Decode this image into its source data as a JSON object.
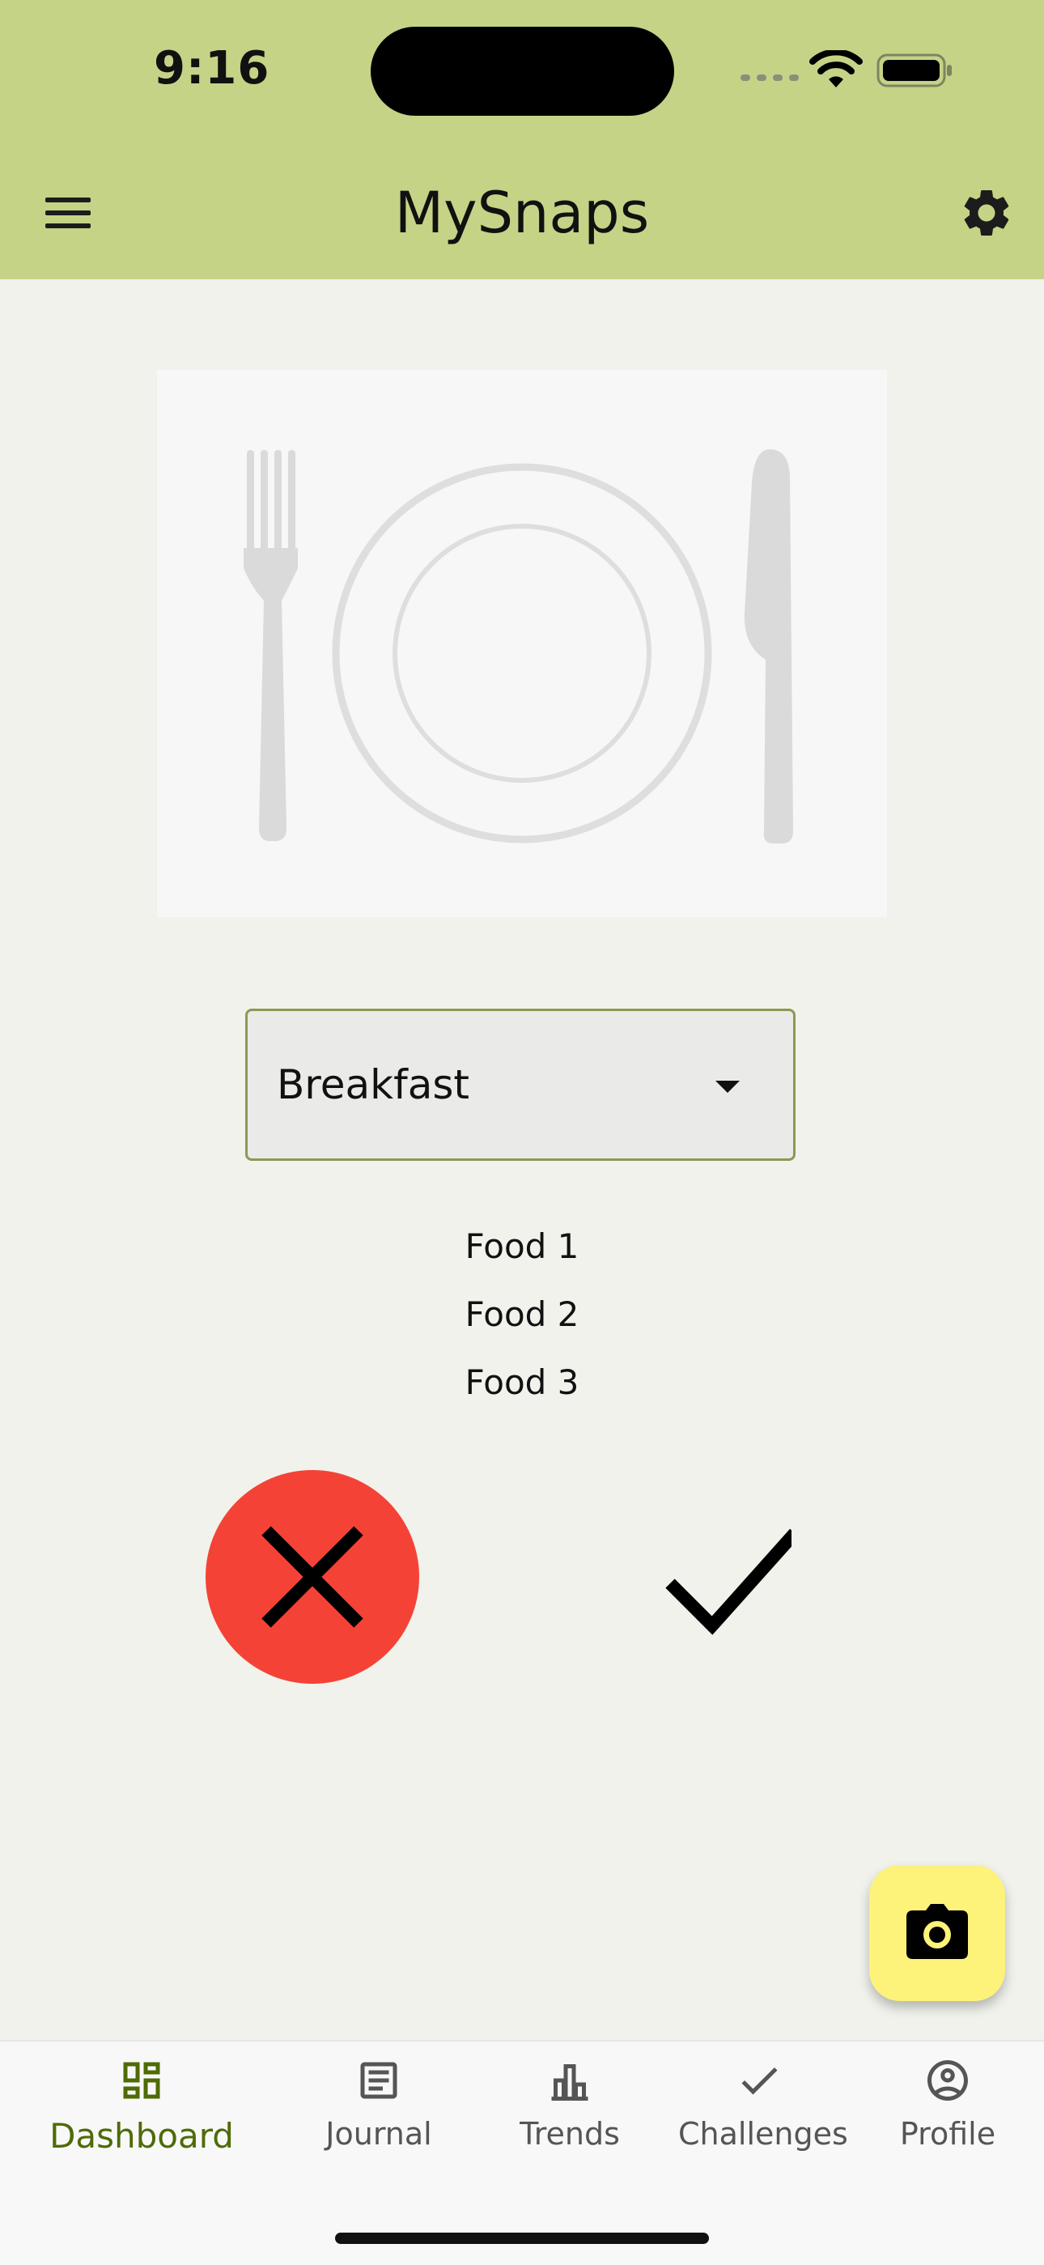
{
  "status_bar": {
    "time": "9:16",
    "icons": [
      "cellular-dots-icon",
      "wifi-icon",
      "battery-icon"
    ]
  },
  "app_bar": {
    "title": "MySnaps",
    "menu_icon": "menu-icon",
    "settings_icon": "gear-icon"
  },
  "hero": {
    "icon": "plate-fork-knife-icon"
  },
  "meal_select": {
    "value": "Breakfast"
  },
  "foods": [
    "Food 1",
    "Food 2",
    "Food 3"
  ],
  "actions": {
    "reject_icon": "close-icon",
    "accept_icon": "check-icon"
  },
  "fab": {
    "icon": "camera-icon"
  },
  "bottom_nav": [
    {
      "label": "Dashboard",
      "icon": "dashboard-icon",
      "active": true
    },
    {
      "label": "Journal",
      "icon": "journal-icon",
      "active": false
    },
    {
      "label": "Trends",
      "icon": "bar-chart-icon",
      "active": false
    },
    {
      "label": "Challenges",
      "icon": "check-icon",
      "active": false
    },
    {
      "label": "Profile",
      "icon": "profile-icon",
      "active": false
    }
  ],
  "colors": {
    "header": "#c5d386",
    "background": "#f1f2ec",
    "reject": "#f44336",
    "fab": "#fdf27a",
    "active_nav": "#4e6b06"
  }
}
